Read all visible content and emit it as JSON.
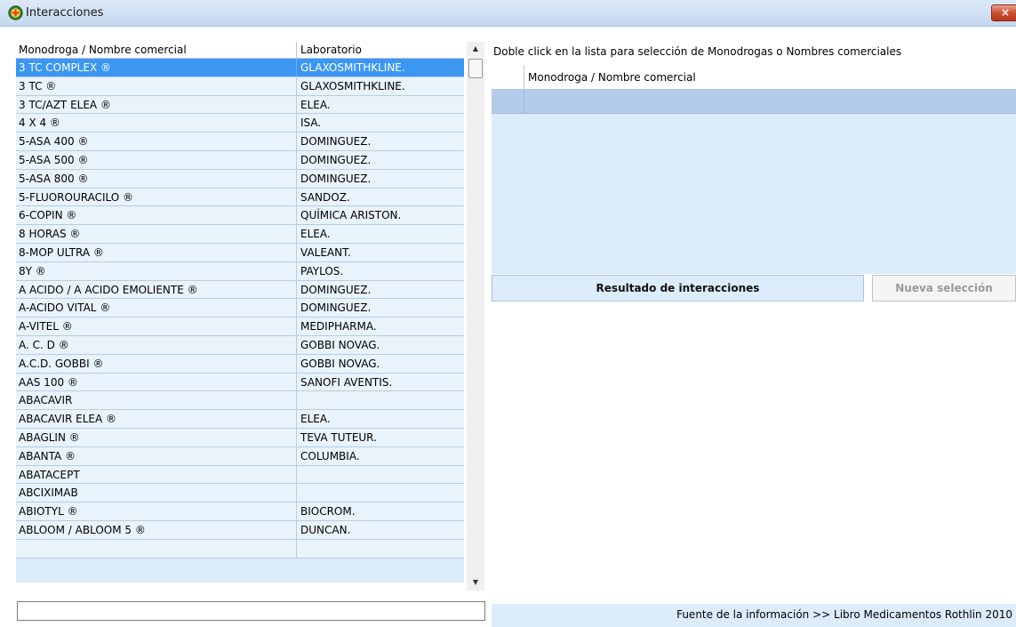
{
  "window": {
    "title": "Interacciones",
    "close_label": "×"
  },
  "drug_list": {
    "columns": {
      "name": "Monodroga / Nombre comercial",
      "lab": "Laboratorio"
    },
    "rows": [
      {
        "name": "3 TC COMPLEX ®",
        "lab": "GLAXOSMITHKLINE.",
        "selected": true
      },
      {
        "name": "3 TC ®",
        "lab": "GLAXOSMITHKLINE."
      },
      {
        "name": "3 TC/AZT ELEA ®",
        "lab": "ELEA."
      },
      {
        "name": "4 X 4 ®",
        "lab": "ISA."
      },
      {
        "name": "5-ASA 400 ®",
        "lab": "DOMINGUEZ."
      },
      {
        "name": "5-ASA 500 ®",
        "lab": "DOMINGUEZ."
      },
      {
        "name": "5-ASA 800 ®",
        "lab": "DOMINGUEZ."
      },
      {
        "name": "5-FLUOROURACILO ®",
        "lab": "SANDOZ."
      },
      {
        "name": "6-COPIN ®",
        "lab": "QUÍMICA ARISTON."
      },
      {
        "name": "8 HORAS ®",
        "lab": "ELEA."
      },
      {
        "name": "8-MOP ULTRA ®",
        "lab": "VALEANT."
      },
      {
        "name": "8Y ®",
        "lab": "PAYLOS."
      },
      {
        "name": "A ACIDO / A ACIDO EMOLIENTE ®",
        "lab": "DOMINGUEZ."
      },
      {
        "name": "A-ACIDO VITAL ®",
        "lab": "DOMINGUEZ."
      },
      {
        "name": "A-VITEL ®",
        "lab": "MEDIPHARMA."
      },
      {
        "name": "A. C. D ®",
        "lab": "GOBBI NOVAG."
      },
      {
        "name": "A.C.D. GOBBI ®",
        "lab": "GOBBI NOVAG."
      },
      {
        "name": "AAS 100 ®",
        "lab": "SANOFI AVENTIS."
      },
      {
        "name": "ABACAVIR",
        "lab": ""
      },
      {
        "name": "ABACAVIR ELEA ®",
        "lab": "ELEA."
      },
      {
        "name": "ABAGLIN ®",
        "lab": "TEVA TUTEUR."
      },
      {
        "name": "ABANTA ®",
        "lab": "COLUMBIA."
      },
      {
        "name": "ABATACEPT",
        "lab": ""
      },
      {
        "name": "ABCIXIMAB",
        "lab": ""
      },
      {
        "name": "ABIOTYL ®",
        "lab": "BIOCROM."
      },
      {
        "name": "ABLOOM / ABLOOM 5 ®",
        "lab": "DUNCAN."
      },
      {
        "name": "",
        "lab": ""
      }
    ]
  },
  "scrollbar": {
    "up_label": "▲",
    "down_label": "▼"
  },
  "search": {
    "value": "",
    "placeholder": ""
  },
  "selection": {
    "instructions": "Doble click en la lista para selección de Monodrogas o Nombres comerciales",
    "column": "Monodroga / Nombre comercial"
  },
  "buttons": {
    "result": "Resultado de interacciones",
    "new_selection": "Nueva selección"
  },
  "footer": {
    "source": "Fuente de la información >> Libro Medicamentos Rothlin 2010"
  },
  "colors": {
    "selected_row": "#3c97f2",
    "row_bg": "#e9f3fc",
    "panel_bg": "#dcecfb"
  }
}
